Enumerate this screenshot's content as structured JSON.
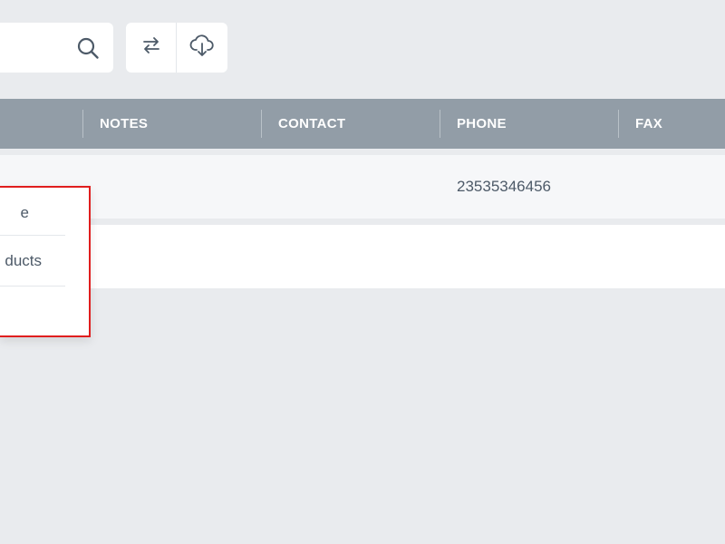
{
  "toolbar": {
    "search": {
      "value": "",
      "placeholder": "",
      "icon": "search-icon"
    },
    "actions": [
      {
        "name": "sync",
        "icon": "arrows-swap-icon"
      },
      {
        "name": "download",
        "icon": "cloud-download-icon"
      }
    ]
  },
  "table": {
    "columns": [
      "NOTES",
      "CONTACT",
      "PHONE",
      "FAX"
    ],
    "rows": [
      {
        "notes": "",
        "contact": "",
        "phone": "23535346456",
        "fax": ""
      },
      {
        "notes": "",
        "contact": "",
        "phone": "",
        "fax": ""
      }
    ]
  },
  "menu": {
    "items": [
      "e",
      "ducts",
      ""
    ]
  },
  "colors": {
    "background": "#e9ebee",
    "header": "#929da7",
    "highlight_border": "#e01e1e",
    "text": "#4d5a68"
  }
}
